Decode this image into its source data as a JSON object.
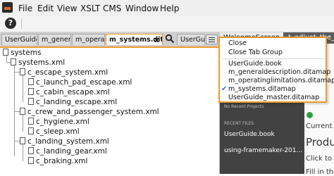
{
  "menubar": {
    "items": [
      "File",
      "Edit",
      "View",
      "XSLT",
      "CMS",
      "Window",
      "Help"
    ]
  },
  "toolbar": {
    "help_label": "?"
  },
  "editor": {
    "tabs": [
      {
        "label": "UserGuide.b",
        "active": false
      },
      {
        "label": "m_generalde",
        "active": false
      },
      {
        "label": "m_operating",
        "active": false
      },
      {
        "label": "m_systems.ditamap",
        "active": true
      },
      {
        "label": "UserGuide_m",
        "active": false
      }
    ],
    "active_tab_close": "x",
    "tree": [
      {
        "label": "systems",
        "level": 0,
        "icon": "doc"
      },
      {
        "label": "systems.xml",
        "level": 1,
        "icon": "doc"
      },
      {
        "label": "c_escape_system.xml",
        "level": 2,
        "icon": "doc"
      },
      {
        "label": "c_launch_pad_escape.xml",
        "level": 3,
        "icon": "doc"
      },
      {
        "label": "c_cabin_escape.xml",
        "level": 3,
        "icon": "doc"
      },
      {
        "label": "c_landing_escape.xml",
        "level": 3,
        "icon": "doc"
      },
      {
        "label": "c_crew_and_passenger_system.xml",
        "level": 2,
        "icon": "doc"
      },
      {
        "label": "c_hygiene.xml",
        "level": 3,
        "icon": "doc"
      },
      {
        "label": "c_sleep.xml",
        "level": 3,
        "icon": "doc"
      },
      {
        "label": "c_landing_system.xml",
        "level": 2,
        "icon": "doc"
      },
      {
        "label": "c_landing_gear.xml",
        "level": 3,
        "icon": "doc"
      },
      {
        "label": "c_braking.xml",
        "level": 3,
        "icon": "doc"
      }
    ]
  },
  "right_panel": {
    "tabs": [
      {
        "label": "WelcomeScreen",
        "active": true
      },
      {
        "label": "t_adjust_the_sea",
        "active": false
      }
    ],
    "no_recent_projects": "No Recent Projects",
    "recent_files_heading": "RECENT FILES",
    "recent_files": [
      "UserGuide.book",
      "using-framemaker-201..."
    ],
    "side_text": {
      "current_ve": "Current ve",
      "produ": "Produ",
      "click_to": "Click to",
      "fill": "Fill in the"
    }
  },
  "tab_dropdown": {
    "items": [
      {
        "label": "Close",
        "checked": false
      },
      {
        "label": "Close Tab Group",
        "checked": false
      },
      {
        "label": "UserGuide.book",
        "checked": false
      },
      {
        "label": "m_generaldescription.ditamap",
        "checked": false
      },
      {
        "label": "m_operatinglimitations.ditamap",
        "checked": false
      },
      {
        "label": "m_systems.ditamap",
        "checked": true
      },
      {
        "label": "UserGuide_master.ditamap",
        "checked": false
      }
    ],
    "check_glyph": "✔"
  },
  "colors": {
    "highlight_border": "#ef9a2b",
    "check_blue": "#2c6fd6",
    "dark_panel": "#424242"
  }
}
